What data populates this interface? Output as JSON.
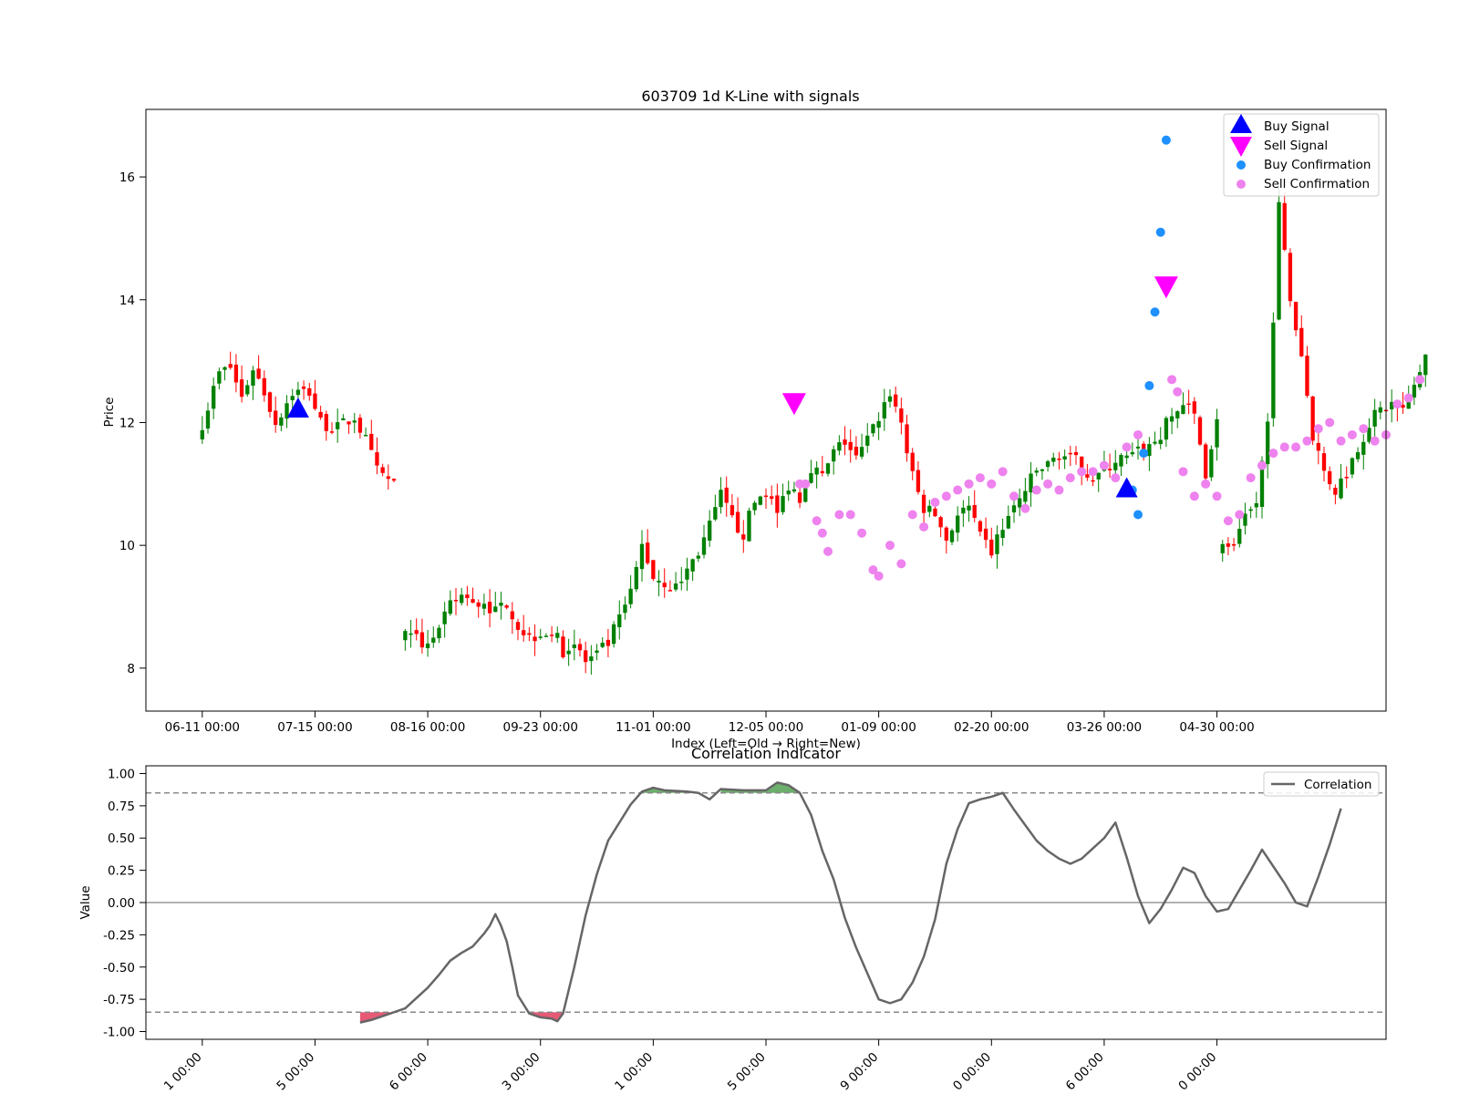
{
  "chart_data": [
    {
      "type": "candlestick",
      "title": "603709 1d K-Line with signals",
      "xlabel": "Index (Left=Old → Right=New)",
      "ylabel": "Price",
      "ylim": [
        7.3,
        17.1
      ],
      "yticks": [
        8,
        10,
        12,
        14,
        16
      ],
      "xlim": [
        -10,
        210
      ],
      "xticks": [
        {
          "index": 0,
          "label": "06-11 00:00"
        },
        {
          "index": 20,
          "label": "07-15 00:00"
        },
        {
          "index": 40,
          "label": "08-16 00:00"
        },
        {
          "index": 60,
          "label": "09-23 00:00"
        },
        {
          "index": 80,
          "label": "11-01 00:00"
        },
        {
          "index": 100,
          "label": "12-05 00:00"
        },
        {
          "index": 120,
          "label": "01-09 00:00"
        },
        {
          "index": 140,
          "label": "02-20 00:00"
        },
        {
          "index": 160,
          "label": "03-26 00:00"
        },
        {
          "index": 180,
          "label": "04-30 00:00"
        }
      ],
      "close_path": [
        [
          0,
          12.0
        ],
        [
          3,
          12.8
        ],
        [
          5,
          12.9
        ],
        [
          7,
          12.4
        ],
        [
          9,
          12.9
        ],
        [
          11,
          12.5
        ],
        [
          13,
          12.0
        ],
        [
          16,
          12.5
        ],
        [
          19,
          12.5
        ],
        [
          21,
          12.0
        ],
        [
          24,
          11.9
        ],
        [
          27,
          12.1
        ],
        [
          29,
          11.7
        ],
        [
          31,
          11.2
        ],
        [
          34,
          11.0
        ],
        [
          36,
          -1
        ],
        [
          36,
          8.5
        ],
        [
          39,
          8.4
        ],
        [
          42,
          8.6
        ],
        [
          44,
          9.0
        ],
        [
          46,
          9.2
        ],
        [
          48,
          9.0
        ],
        [
          50,
          9.1
        ],
        [
          52,
          8.9
        ],
        [
          54,
          9.1
        ],
        [
          56,
          8.7
        ],
        [
          58,
          8.5
        ],
        [
          60,
          8.6
        ],
        [
          62,
          8.6
        ],
        [
          64,
          8.3
        ],
        [
          66,
          8.4
        ],
        [
          68,
          8.1
        ],
        [
          70,
          8.2
        ],
        [
          72,
          8.4
        ],
        [
          74,
          8.8
        ],
        [
          76,
          9.2
        ],
        [
          78,
          10.0
        ],
        [
          80,
          9.5
        ],
        [
          82,
          9.4
        ],
        [
          84,
          9.3
        ],
        [
          86,
          9.6
        ],
        [
          88,
          9.9
        ],
        [
          90,
          10.3
        ],
        [
          92,
          10.8
        ],
        [
          94,
          10.4
        ],
        [
          96,
          10.2
        ],
        [
          98,
          10.7
        ],
        [
          100,
          10.9
        ],
        [
          102,
          10.5
        ],
        [
          104,
          11.0
        ],
        [
          106,
          10.8
        ],
        [
          108,
          11.3
        ],
        [
          110,
          11.1
        ],
        [
          112,
          11.5
        ],
        [
          114,
          11.7
        ],
        [
          116,
          11.4
        ],
        [
          118,
          11.7
        ],
        [
          120,
          12.1
        ],
        [
          122,
          12.5
        ],
        [
          124,
          12.0
        ],
        [
          126,
          11.1
        ],
        [
          128,
          10.6
        ],
        [
          130,
          10.5
        ],
        [
          132,
          10.1
        ],
        [
          134,
          10.5
        ],
        [
          136,
          10.6
        ],
        [
          138,
          10.1
        ],
        [
          140,
          9.9
        ],
        [
          142,
          10.3
        ],
        [
          144,
          10.6
        ],
        [
          146,
          10.9
        ],
        [
          148,
          11.2
        ],
        [
          150,
          11.3
        ],
        [
          152,
          11.5
        ],
        [
          154,
          11.4
        ],
        [
          156,
          11.3
        ],
        [
          158,
          11.1
        ],
        [
          160,
          11.2
        ],
        [
          162,
          11.4
        ],
        [
          164,
          11.4
        ],
        [
          166,
          11.5
        ],
        [
          168,
          11.6
        ],
        [
          170,
          11.8
        ],
        [
          172,
          12.1
        ],
        [
          174,
          12.3
        ],
        [
          176,
          12.1
        ],
        [
          178,
          11.2
        ],
        [
          180,
          12.0
        ],
        [
          181,
          -1
        ],
        [
          181,
          10.1
        ],
        [
          183,
          9.9
        ],
        [
          185,
          10.4
        ],
        [
          187,
          10.7
        ],
        [
          189,
          12.0
        ],
        [
          191,
          15.5
        ],
        [
          193,
          14.0
        ],
        [
          195,
          13.1
        ],
        [
          197,
          11.8
        ],
        [
          199,
          11.2
        ],
        [
          201,
          10.9
        ],
        [
          203,
          11.2
        ],
        [
          205,
          11.6
        ],
        [
          207,
          12.0
        ],
        [
          209,
          12.2
        ],
        [
          211,
          12.3
        ],
        [
          213,
          12.2
        ],
        [
          215,
          12.6
        ],
        [
          217,
          13.1
        ]
      ],
      "buy_signals": [
        [
          17,
          12.2
        ],
        [
          164,
          10.9
        ]
      ],
      "sell_signals": [
        [
          105,
          12.3
        ],
        [
          171,
          14.2
        ]
      ],
      "buy_confirmations": [
        [
          165,
          10.9
        ],
        [
          166,
          10.5
        ],
        [
          167,
          11.5
        ],
        [
          168,
          12.6
        ],
        [
          169,
          13.8
        ],
        [
          170,
          15.1
        ],
        [
          171,
          16.6
        ]
      ],
      "sell_confirmations": [
        [
          106,
          11.0
        ],
        [
          107,
          11.0
        ],
        [
          109,
          10.4
        ],
        [
          110,
          10.2
        ],
        [
          111,
          9.9
        ],
        [
          113,
          10.5
        ],
        [
          115,
          10.5
        ],
        [
          117,
          10.2
        ],
        [
          119,
          9.6
        ],
        [
          120,
          9.5
        ],
        [
          122,
          10.0
        ],
        [
          124,
          9.7
        ],
        [
          126,
          10.5
        ],
        [
          128,
          10.3
        ],
        [
          130,
          10.7
        ],
        [
          132,
          10.8
        ],
        [
          134,
          10.9
        ],
        [
          136,
          11.0
        ],
        [
          138,
          11.1
        ],
        [
          140,
          11.0
        ],
        [
          142,
          11.2
        ],
        [
          144,
          10.8
        ],
        [
          146,
          10.6
        ],
        [
          148,
          10.9
        ],
        [
          150,
          11.0
        ],
        [
          152,
          10.9
        ],
        [
          154,
          11.1
        ],
        [
          156,
          11.2
        ],
        [
          158,
          11.2
        ],
        [
          160,
          11.3
        ],
        [
          162,
          11.1
        ],
        [
          164,
          11.6
        ],
        [
          166,
          11.8
        ],
        [
          172,
          12.7
        ],
        [
          173,
          12.5
        ],
        [
          174,
          11.2
        ],
        [
          176,
          10.8
        ],
        [
          178,
          11.0
        ],
        [
          180,
          10.8
        ],
        [
          182,
          10.4
        ],
        [
          184,
          10.5
        ],
        [
          186,
          11.1
        ],
        [
          188,
          11.3
        ],
        [
          190,
          11.5
        ],
        [
          192,
          11.6
        ],
        [
          194,
          11.6
        ],
        [
          196,
          11.7
        ],
        [
          198,
          11.9
        ],
        [
          200,
          12.0
        ],
        [
          202,
          11.7
        ],
        [
          204,
          11.8
        ],
        [
          206,
          11.9
        ],
        [
          208,
          11.7
        ],
        [
          210,
          11.8
        ],
        [
          212,
          12.3
        ],
        [
          214,
          12.4
        ],
        [
          216,
          12.7
        ]
      ],
      "legend": {
        "position": "top-right",
        "entries": [
          {
            "name": "Buy Signal",
            "color": "#0000ff",
            "marker": "triangle-up"
          },
          {
            "name": "Sell Signal",
            "color": "#ff00ff",
            "marker": "triangle-down"
          },
          {
            "name": "Buy Confirmation",
            "color": "#1e90ff",
            "marker": "circle"
          },
          {
            "name": "Sell Confirmation",
            "color": "#ee82ee",
            "marker": "circle"
          }
        ]
      },
      "colors": {
        "up": "#008000",
        "down": "#ff0000"
      }
    },
    {
      "type": "line",
      "title": "Correlation Indicator",
      "xlabel": "",
      "ylabel": "Value",
      "ylim": [
        -1.06,
        1.06
      ],
      "yticks": [
        -1.0,
        -0.75,
        -0.5,
        -0.25,
        0.0,
        0.25,
        0.5,
        0.75,
        1.0
      ],
      "xlim": [
        -10,
        210
      ],
      "xtick_labels": [
        "1 00:00",
        "5 00:00",
        "6 00:00",
        "3 00:00",
        "1 00:00",
        "5 00:00",
        "9 00:00",
        "0 00:00",
        "6 00:00",
        "0 00:00"
      ],
      "thresholds": [
        0.85,
        -0.85
      ],
      "zero_line": 0.0,
      "series": [
        {
          "name": "Correlation",
          "color": "#666666",
          "points": [
            [
              28,
              -0.93
            ],
            [
              30,
              -0.91
            ],
            [
              32,
              -0.88
            ],
            [
              34,
              -0.85
            ],
            [
              36,
              -0.82
            ],
            [
              38,
              -0.74
            ],
            [
              40,
              -0.66
            ],
            [
              42,
              -0.56
            ],
            [
              44,
              -0.45
            ],
            [
              46,
              -0.39
            ],
            [
              48,
              -0.34
            ],
            [
              50,
              -0.24
            ],
            [
              51,
              -0.18
            ],
            [
              52,
              -0.09
            ],
            [
              53,
              -0.18
            ],
            [
              54,
              -0.3
            ],
            [
              55,
              -0.5
            ],
            [
              56,
              -0.72
            ],
            [
              58,
              -0.86
            ],
            [
              60,
              -0.89
            ],
            [
              62,
              -0.9
            ],
            [
              63,
              -0.92
            ],
            [
              64,
              -0.86
            ],
            [
              66,
              -0.5
            ],
            [
              68,
              -0.1
            ],
            [
              70,
              0.22
            ],
            [
              72,
              0.48
            ],
            [
              74,
              0.62
            ],
            [
              76,
              0.76
            ],
            [
              78,
              0.86
            ],
            [
              80,
              0.89
            ],
            [
              82,
              0.87
            ],
            [
              86,
              0.86
            ],
            [
              88,
              0.85
            ],
            [
              90,
              0.8
            ],
            [
              92,
              0.88
            ],
            [
              96,
              0.87
            ],
            [
              100,
              0.87
            ],
            [
              102,
              0.93
            ],
            [
              104,
              0.91
            ],
            [
              106,
              0.85
            ],
            [
              108,
              0.68
            ],
            [
              110,
              0.4
            ],
            [
              112,
              0.18
            ],
            [
              114,
              -0.12
            ],
            [
              116,
              -0.35
            ],
            [
              118,
              -0.55
            ],
            [
              120,
              -0.75
            ],
            [
              122,
              -0.78
            ],
            [
              124,
              -0.75
            ],
            [
              126,
              -0.62
            ],
            [
              128,
              -0.42
            ],
            [
              130,
              -0.13
            ],
            [
              132,
              0.3
            ],
            [
              134,
              0.57
            ],
            [
              136,
              0.77
            ],
            [
              138,
              0.8
            ],
            [
              140,
              0.82
            ],
            [
              142,
              0.85
            ],
            [
              144,
              0.72
            ],
            [
              146,
              0.6
            ],
            [
              148,
              0.48
            ],
            [
              150,
              0.4
            ],
            [
              152,
              0.34
            ],
            [
              154,
              0.3
            ],
            [
              156,
              0.34
            ],
            [
              158,
              0.42
            ],
            [
              160,
              0.5
            ],
            [
              162,
              0.62
            ],
            [
              164,
              0.35
            ],
            [
              166,
              0.05
            ],
            [
              168,
              -0.16
            ],
            [
              170,
              -0.05
            ],
            [
              172,
              0.1
            ],
            [
              174,
              0.27
            ],
            [
              176,
              0.23
            ],
            [
              178,
              0.05
            ],
            [
              180,
              -0.07
            ],
            [
              182,
              -0.05
            ],
            [
              184,
              0.1
            ],
            [
              186,
              0.25
            ],
            [
              188,
              0.41
            ],
            [
              190,
              0.28
            ],
            [
              192,
              0.15
            ],
            [
              194,
              0.0
            ],
            [
              196,
              -0.03
            ],
            [
              198,
              0.2
            ],
            [
              200,
              0.45
            ],
            [
              202,
              0.73
            ]
          ]
        }
      ],
      "legend": {
        "position": "top-right"
      },
      "fill_colors": {
        "above": "#2e8b2e",
        "below": "#dc143c"
      }
    }
  ]
}
